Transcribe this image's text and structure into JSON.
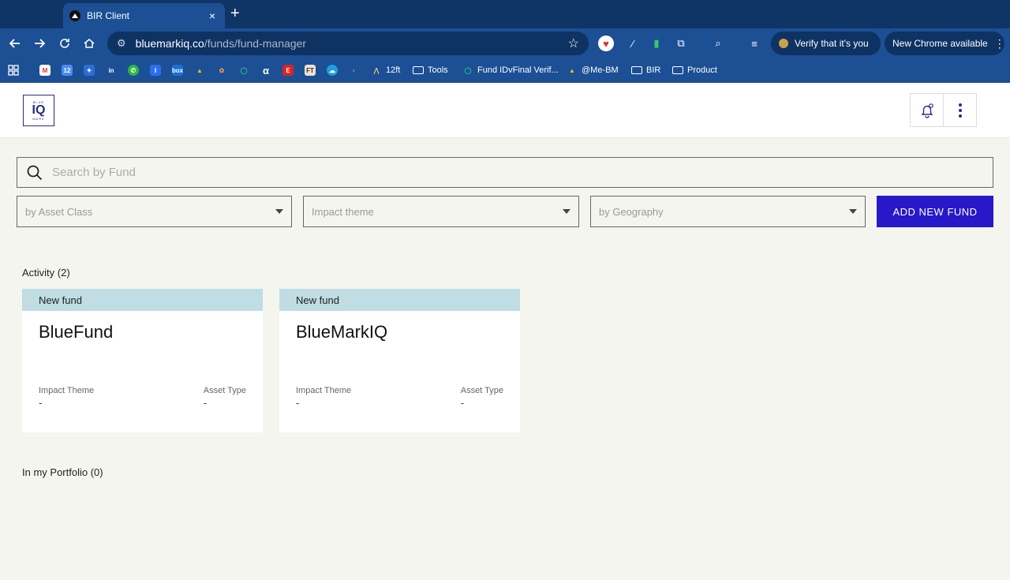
{
  "browser": {
    "tab_title": "BIR Client",
    "tab_close": "×",
    "new_tab": "+",
    "url_host": "bluemarkiq.co",
    "url_path": "/funds/fund-manager",
    "verify_label": "Verify that it's you",
    "update_label": "New Chrome available",
    "bookmarks": [
      {
        "label": "12ft"
      },
      {
        "label": "Tools"
      },
      {
        "label": "Fund IDvFinal Verif..."
      },
      {
        "label": "@Me-BM"
      },
      {
        "label": "BIR"
      },
      {
        "label": "Product"
      }
    ]
  },
  "app": {
    "logo_top": "BLUE",
    "logo_main": "IQ",
    "logo_bottom": "MARK",
    "search_placeholder": "Search by Fund",
    "filters": {
      "asset_class": "by Asset Class",
      "impact_theme": "Impact theme",
      "geography": "by Geography"
    },
    "add_button": "ADD NEW FUND",
    "activity_title": "Activity (2)",
    "portfolio_title": "In my Portfolio (0)",
    "cards": [
      {
        "band": "New fund",
        "name": "BlueFund",
        "impact_label": "Impact Theme",
        "impact_value": "-",
        "asset_label": "Asset Type",
        "asset_value": "-"
      },
      {
        "band": "New fund",
        "name": "BlueMarkIQ",
        "impact_label": "Impact Theme",
        "impact_value": "-",
        "asset_label": "Asset Type",
        "asset_value": "-"
      }
    ]
  },
  "colors": {
    "chrome_dark": "#0f3566",
    "chrome": "#1c4f94",
    "brand": "#2719c7",
    "card_band": "#bfdde2"
  }
}
